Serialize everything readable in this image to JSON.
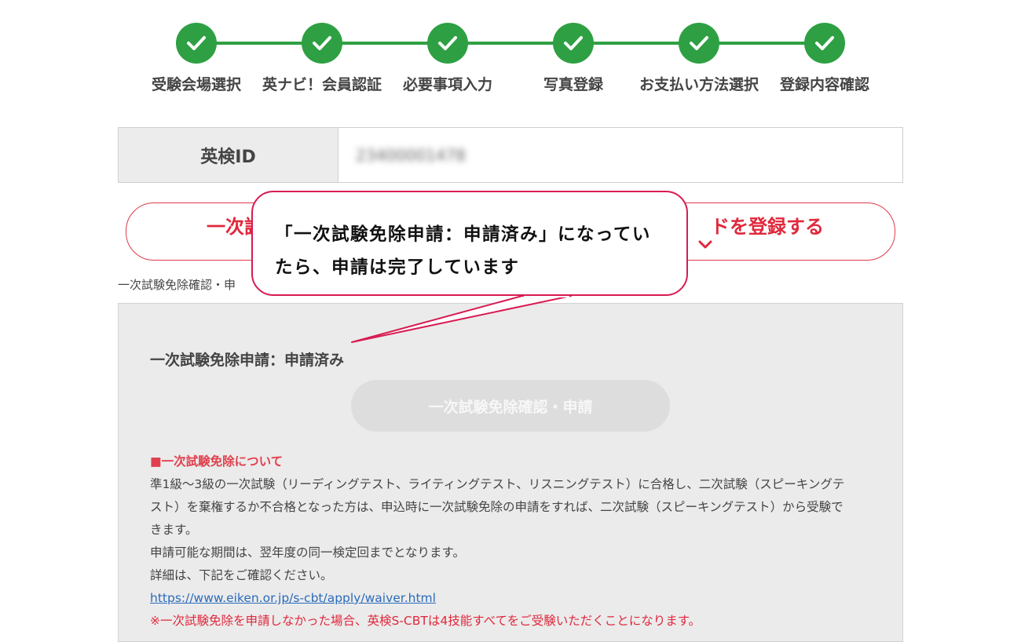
{
  "colors": {
    "step_green": "#2ea043",
    "accent_red": "#e0283c",
    "callout_border": "#d81b52"
  },
  "stepper": {
    "steps": [
      {
        "label": "受験会場選択",
        "icon": "check-icon"
      },
      {
        "label": "英ナビ！会員認証",
        "icon": "check-icon"
      },
      {
        "label": "必要事項入力",
        "icon": "check-icon"
      },
      {
        "label": "写真登録",
        "icon": "check-icon"
      },
      {
        "label": "お支払い方法選択",
        "icon": "check-icon"
      },
      {
        "label": "登録内容確認",
        "icon": "check-icon"
      }
    ]
  },
  "id_table": {
    "label": "英検ID",
    "value": "23400001478"
  },
  "register_button": {
    "label_left": "一次試",
    "label_right": "ドを登録する",
    "chevron_icon": "chevron-down-icon"
  },
  "caption_small": "一次試験免除確認・申",
  "panel": {
    "status": "一次試験免除申請：申請済み",
    "disabled_button": "一次試験免除確認・申請",
    "heading": "■一次試験免除について",
    "paragraph_lines": [
      "準1級〜3級の一次試験（リーディングテスト、ライティングテスト、リスニングテスト）に合格し、二次試験（スピーキングテ",
      "スト）を棄権するか不合格となった方は、申込時に一次試験免除の申請をすれば、二次試験（スピーキングテスト）から受験で",
      "きます。"
    ],
    "period": "申請可能な期間は、翌年度の同一検定回までとなります。",
    "details": "詳細は、下記をご確認ください。",
    "link": "https://www.eiken.or.jp/s-cbt/apply/waiver.html",
    "note": "※一次試験免除を申請しなかった場合、英検S-CBTは4技能すべてをご受験いただくことになります。"
  },
  "callout": {
    "line1": "「一次試験免除申請：申請済み」になってい",
    "line2": "たら、申請は完了しています"
  }
}
